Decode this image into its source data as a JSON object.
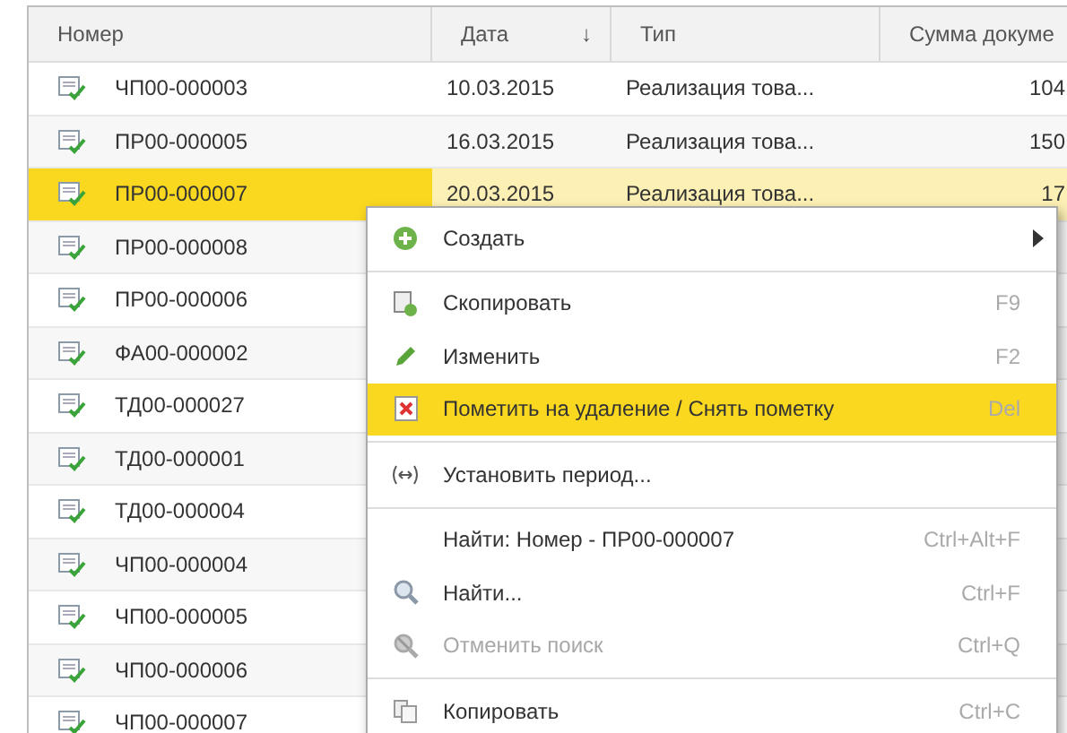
{
  "table": {
    "columns": [
      {
        "label": "Номер"
      },
      {
        "label": "Дата",
        "sort_mark": "↓"
      },
      {
        "label": "Тип"
      },
      {
        "label": "Сумма докуме"
      }
    ],
    "rows": [
      {
        "number": "ЧП00-000003",
        "date": "10.03.2015",
        "type": "Реализация това...",
        "sum": "104",
        "selected": false
      },
      {
        "number": "ПР00-000005",
        "date": "16.03.2015",
        "type": "Реализация това...",
        "sum": "150",
        "selected": false
      },
      {
        "number": "ПР00-000007",
        "date": "20.03.2015",
        "type": "Реализация това...",
        "sum": "17",
        "selected": true
      },
      {
        "number": "ПР00-000008",
        "selected": false
      },
      {
        "number": "ПР00-000006",
        "selected": false
      },
      {
        "number": "ФА00-000002",
        "selected": false
      },
      {
        "number": "ТД00-000027",
        "selected": false
      },
      {
        "number": "ТД00-000001",
        "selected": false
      },
      {
        "number": "ТД00-000004",
        "selected": false
      },
      {
        "number": "ЧП00-000004",
        "selected": false
      },
      {
        "number": "ЧП00-000005",
        "selected": false
      },
      {
        "number": "ЧП00-000006",
        "selected": false
      },
      {
        "number": "ЧП00-000007",
        "selected": false
      }
    ]
  },
  "context_menu": {
    "items": [
      {
        "kind": "item",
        "label": "Создать",
        "submenu": true,
        "selected": false,
        "disabled": false
      },
      {
        "kind": "separator"
      },
      {
        "kind": "item",
        "label": "Скопировать",
        "shortcut": "F9",
        "submenu": false,
        "selected": false,
        "disabled": false
      },
      {
        "kind": "item",
        "label": "Изменить",
        "shortcut": "F2",
        "submenu": false,
        "selected": false,
        "disabled": false
      },
      {
        "kind": "item",
        "label": "Пометить на удаление / Снять пометку",
        "shortcut": "Del",
        "submenu": false,
        "selected": true,
        "disabled": false
      },
      {
        "kind": "separator"
      },
      {
        "kind": "item",
        "label": "Установить период...",
        "submenu": false,
        "selected": false,
        "disabled": false
      },
      {
        "kind": "separator"
      },
      {
        "kind": "item",
        "label": "Найти: Номер - ПР00-000007",
        "shortcut": "Ctrl+Alt+F",
        "submenu": false,
        "selected": false,
        "disabled": false
      },
      {
        "kind": "item",
        "label": "Найти...",
        "shortcut": "Ctrl+F",
        "submenu": false,
        "selected": false,
        "disabled": false
      },
      {
        "kind": "item",
        "label": "Отменить поиск",
        "shortcut": "Ctrl+Q",
        "submenu": false,
        "selected": false,
        "disabled": true
      },
      {
        "kind": "separator"
      },
      {
        "kind": "item",
        "label": "Копировать",
        "shortcut": "Ctrl+C",
        "submenu": false,
        "selected": false,
        "disabled": false
      }
    ]
  }
}
